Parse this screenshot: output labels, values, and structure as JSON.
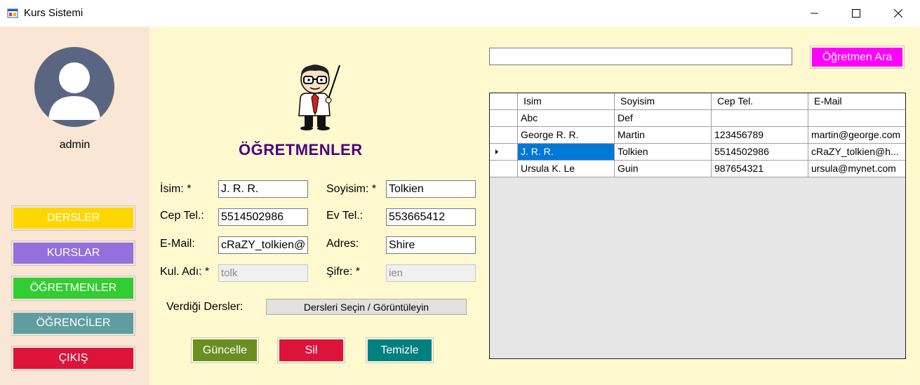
{
  "window": {
    "title": "Kurs Sistemi"
  },
  "sidebar": {
    "user": "admin",
    "buttons": [
      {
        "label": "DERSLER",
        "bg": "#ffd700",
        "fg": "#ffffff"
      },
      {
        "label": "KURSLAR",
        "bg": "#9370db",
        "fg": "#ffffff"
      },
      {
        "label": "ÖĞRETMENLER",
        "bg": "#32cd32",
        "fg": "#ffffff"
      },
      {
        "label": "ÖĞRENCİLER",
        "bg": "#5f9ea0",
        "fg": "#ffffff"
      },
      {
        "label": "ÇIKIŞ",
        "bg": "#dc143c",
        "fg": "#ffffff"
      }
    ]
  },
  "form": {
    "title": "ÖĞRETMENLER",
    "fields": {
      "isim": {
        "label": "İsim: *",
        "value": "J. R. R."
      },
      "soyisim": {
        "label": "Soyisim: *",
        "value": "Tolkien"
      },
      "cep_tel": {
        "label": "Cep Tel.:",
        "value": "5514502986"
      },
      "ev_tel": {
        "label": "Ev Tel.:",
        "value": "553665412"
      },
      "email": {
        "label": "E-Mail:",
        "value": "cRaZY_tolkien@"
      },
      "adres": {
        "label": "Adres:",
        "value": "Shire"
      },
      "kul_adi": {
        "label": "Kul. Adı: *",
        "value": "tolk"
      },
      "sifre": {
        "label": "Şifre: *",
        "value": "ien"
      }
    },
    "dersler_label": "Verdiği Dersler:",
    "dersler_button": "Dersleri Seçin / Görüntüleyin",
    "actions": {
      "update": {
        "label": "Güncelle",
        "bg": "#6b8e23"
      },
      "delete": {
        "label": "Sil",
        "bg": "#dc143c"
      },
      "clear": {
        "label": "Temizle",
        "bg": "#008080"
      }
    }
  },
  "search": {
    "value": "",
    "button_label": "Öğretmen Ara",
    "button_bg": "#ff00ff"
  },
  "table": {
    "columns": [
      "Isim",
      "Soyisim",
      "Cep Tel.",
      "E-Mail"
    ],
    "rows": [
      [
        "Abc",
        "Def",
        "",
        ""
      ],
      [
        "George R. R.",
        "Martin",
        "123456789",
        "martin@george.com"
      ],
      [
        "J. R. R.",
        "Tolkien",
        "5514502986",
        "cRaZY_tolkien@h..."
      ],
      [
        "Ursula K. Le",
        "Guin",
        "987654321",
        "ursula@mynet.com"
      ]
    ],
    "selected_row": 2,
    "selection_color": "#0078d7"
  }
}
